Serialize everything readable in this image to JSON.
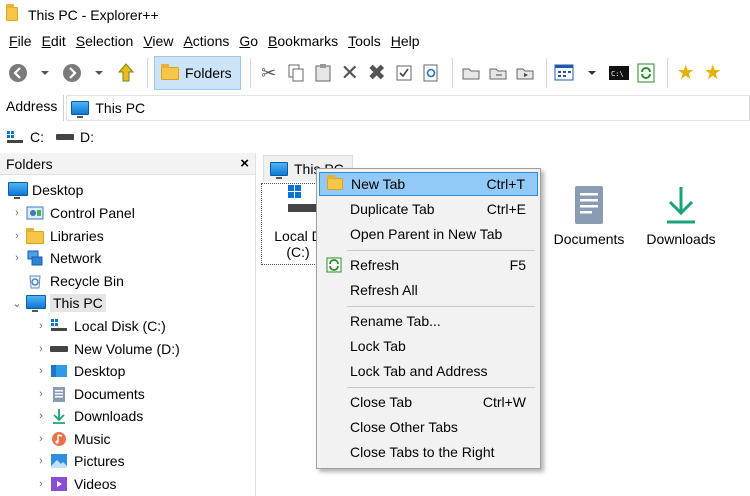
{
  "window": {
    "title": "This PC - Explorer++"
  },
  "menu": [
    {
      "u": "F",
      "rest": "ile"
    },
    {
      "u": "E",
      "rest": "dit"
    },
    {
      "u": "S",
      "rest": "election"
    },
    {
      "u": "V",
      "rest": "iew"
    },
    {
      "u": "A",
      "rest": "ctions"
    },
    {
      "u": "G",
      "rest": "o"
    },
    {
      "u": "B",
      "rest": "ookmarks"
    },
    {
      "u": "T",
      "rest": "ools"
    },
    {
      "u": "H",
      "rest": "elp"
    }
  ],
  "toolbar": {
    "folders_label": "Folders"
  },
  "address": {
    "label": "Address",
    "value": "This PC"
  },
  "drives": [
    {
      "label": "C:"
    },
    {
      "label": "D:"
    }
  ],
  "folders_pane": {
    "header": "Folders",
    "close_glyph": "×",
    "items": [
      {
        "label": "Desktop"
      },
      {
        "label": "Control Panel"
      },
      {
        "label": "Libraries"
      },
      {
        "label": "Network"
      },
      {
        "label": "Recycle Bin"
      },
      {
        "label": "This PC"
      },
      {
        "label": "Local Disk (C:)"
      },
      {
        "label": "New Volume (D:)"
      },
      {
        "label": "Desktop"
      },
      {
        "label": "Documents"
      },
      {
        "label": "Downloads"
      },
      {
        "label": "Music"
      },
      {
        "label": "Pictures"
      },
      {
        "label": "Videos"
      }
    ]
  },
  "tab": {
    "label": "This PC"
  },
  "files": [
    {
      "label": "Local D",
      "label2": "(C:)"
    },
    {
      "label": "Documents"
    },
    {
      "label": "Downloads"
    }
  ],
  "context_menu": {
    "items": [
      {
        "label": "New Tab",
        "shortcut": "Ctrl+T"
      },
      {
        "label": "Duplicate Tab",
        "shortcut": "Ctrl+E"
      },
      {
        "label": "Open Parent in New Tab",
        "shortcut": ""
      },
      {
        "label": "Refresh",
        "shortcut": "F5"
      },
      {
        "label": "Refresh All",
        "shortcut": ""
      },
      {
        "label": "Rename Tab...",
        "shortcut": ""
      },
      {
        "label": "Lock Tab",
        "shortcut": ""
      },
      {
        "label": "Lock Tab and Address",
        "shortcut": ""
      },
      {
        "label": "Close Tab",
        "shortcut": "Ctrl+W"
      },
      {
        "label": "Close Other Tabs",
        "shortcut": ""
      },
      {
        "label": "Close Tabs to the Right",
        "shortcut": ""
      }
    ]
  },
  "colors": {
    "accent": "#0f78d4",
    "highlight": "#91c9f7",
    "folder": "#f6c54a"
  }
}
